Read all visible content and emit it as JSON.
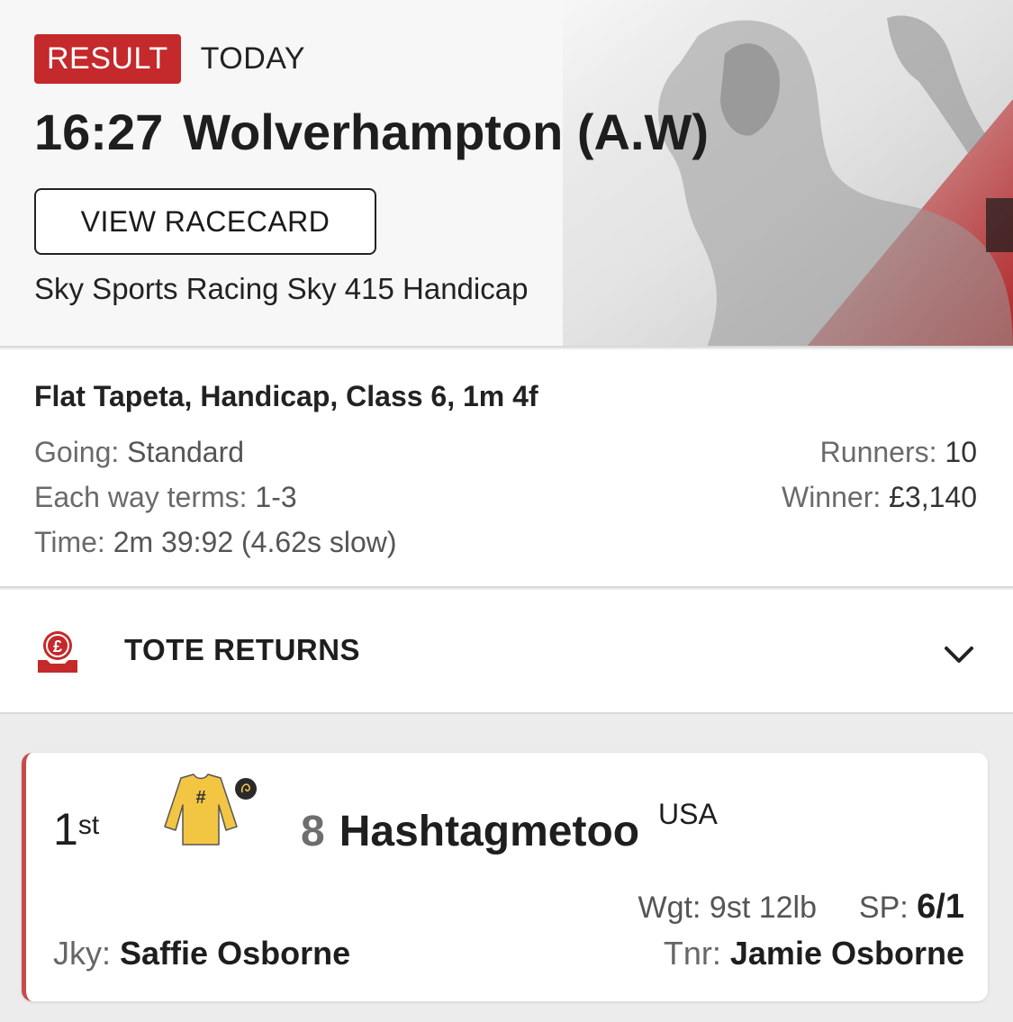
{
  "header": {
    "badge": "RESULT",
    "day": "TODAY",
    "time": "16:27",
    "course": "Wolverhampton (A.W)",
    "racecard_button": "VIEW RACECARD",
    "race_name": "Sky Sports Racing Sky 415 Handicap"
  },
  "info": {
    "race_type": "Flat Tapeta, Handicap, Class 6, 1m 4f",
    "going_label": "Going:",
    "going_value": "Standard",
    "each_way_label": "Each way terms:",
    "each_way_value": "1-3",
    "time_label": "Time:",
    "time_value": "2m 39:92 (4.62s slow)",
    "runners_label": "Runners:",
    "runners_value": "10",
    "winner_label": "Winner:",
    "winner_value": "£3,140"
  },
  "tote": {
    "label": "TOTE RETURNS",
    "icon": "pound-coin-icon"
  },
  "result": {
    "position": "1",
    "position_suffix": "st",
    "number": "8",
    "horse": "Hashtagmetoo",
    "country": "USA",
    "silks_mark": "#",
    "weight_label": "Wgt:",
    "weight_value": "9st 12lb",
    "sp_label": "SP:",
    "sp_value": "6/1",
    "jockey_label": "Jky:",
    "jockey_value": "Saffie Osborne",
    "trainer_label": "Tnr:",
    "trainer_value": "Jamie Osborne"
  },
  "colors": {
    "accent": "#c4292b",
    "silks": "#f2c543"
  }
}
